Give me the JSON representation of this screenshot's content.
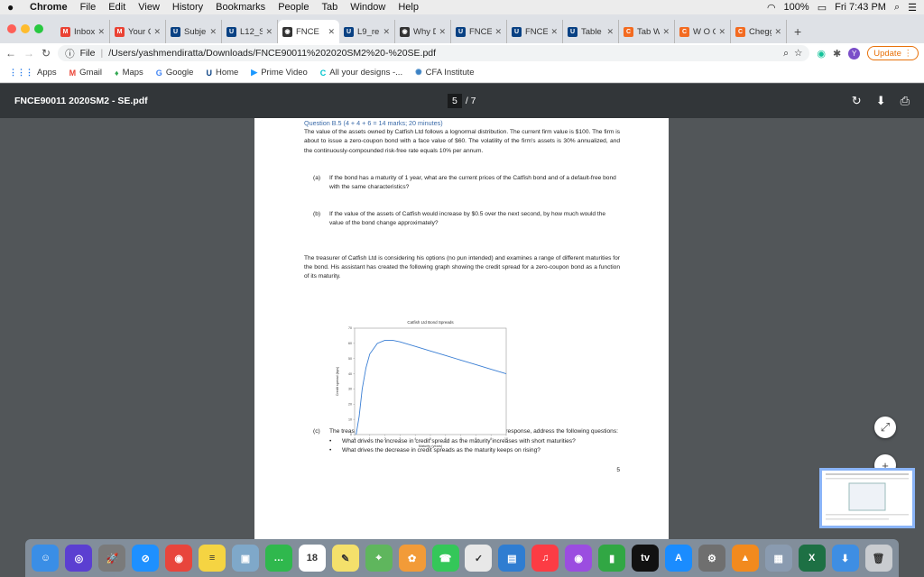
{
  "menubar": {
    "apple": "",
    "items": [
      "Chrome",
      "File",
      "Edit",
      "View",
      "History",
      "Bookmarks",
      "People",
      "Tab",
      "Window",
      "Help"
    ],
    "battery": "100%",
    "clock": "Fri 7:43 PM"
  },
  "tabs": [
    {
      "label": "Inbox",
      "icon": "M",
      "color": "#ea4335"
    },
    {
      "label": "Your C",
      "icon": "M",
      "color": "#ea4335"
    },
    {
      "label": "Subje",
      "icon": "U",
      "color": "#094183"
    },
    {
      "label": "L12_S",
      "icon": "U",
      "color": "#094183"
    },
    {
      "label": "FNCE",
      "icon": "◉",
      "color": "#333333"
    },
    {
      "label": "L9_re",
      "icon": "U",
      "color": "#094183"
    },
    {
      "label": "Why D",
      "icon": "◉",
      "color": "#333333"
    },
    {
      "label": "FNCE",
      "icon": "U",
      "color": "#094183"
    },
    {
      "label": "FNCE",
      "icon": "U",
      "color": "#094183"
    },
    {
      "label": "Table",
      "icon": "U",
      "color": "#094183"
    },
    {
      "label": "Tab W",
      "icon": "C",
      "color": "#f36b21"
    },
    {
      "label": "W O C",
      "icon": "C",
      "color": "#f36b21"
    },
    {
      "label": "Chegg",
      "icon": "C",
      "color": "#f36b21"
    }
  ],
  "active_tab_index": 4,
  "toolbar": {
    "file_label": "File",
    "url": "/Users/yashmendiratta/Downloads/FNCE90011%202020SM2%20-%20SE.pdf",
    "avatar_letter": "Y",
    "update_label": "Update"
  },
  "bookmarks": [
    {
      "label": "Apps",
      "icon": "⋮⋮⋮",
      "color": "#1a73e8"
    },
    {
      "label": "Gmail",
      "icon": "M",
      "color": "#ea4335"
    },
    {
      "label": "Maps",
      "icon": "♦",
      "color": "#34a853"
    },
    {
      "label": "Google",
      "icon": "G",
      "color": "#4285f4"
    },
    {
      "label": "Home",
      "icon": "U",
      "color": "#094183"
    },
    {
      "label": "Prime Video",
      "icon": "▶",
      "color": "#1a98ff"
    },
    {
      "label": "All your designs -...",
      "icon": "C",
      "color": "#00c4cc"
    },
    {
      "label": "CFA Institute",
      "icon": "✺",
      "color": "#3b82c4"
    }
  ],
  "pdf": {
    "title": "FNCE90011 2020SM2 - SE.pdf",
    "current_page": "5",
    "total_pages": "/ 7"
  },
  "question": {
    "heading": "Question B.5 (4 + 4 + 6 = 14 marks; 20 minutes)",
    "intro": "The value of the assets owned by Catfish Ltd follows a lognormal distribution. The current firm value is $100. The firm is about to issue a zero-coupon bond with a face value of $60. The volatility of the firm's assets is 30% annualized, and the continuously-compounded risk-free rate equals 10% per annum.",
    "a_label": "(a)",
    "a_text": "If the bond has a maturity of 1 year, what are the current prices of the Catfish bond and of a default-free bond with the same characteristics?",
    "b_label": "(b)",
    "b_text": "If the value of the assets of Catfish would increase by $0.5 over the next second, by how much would the value of the bond change approximately?",
    "treasurer": "The treasurer of Catfish Ltd is considering his options (no pun intended) and examines a range of different maturities for the bond. His assistant has created the following graph showing the credit spread for a zero-coupon bond as a function of its maturity.",
    "c_label": "(c)",
    "c_text": "The treasurer asks you for advice to understand the graph. In your response, address the following questions:",
    "bullets": [
      "What drives the increase in credit spread as the maturity increases with short maturities?",
      "What drives the decrease in credit spreads as the maturity keeps on rising?"
    ],
    "page_number": "5"
  },
  "chart_data": {
    "type": "line",
    "title": "Catfish Ltd Bond Spreads",
    "xlabel": "Maturity (years)",
    "ylabel": "Credit spread (bps)",
    "xlim": [
      0,
      10
    ],
    "ylim": [
      0,
      70
    ],
    "xticks": [
      "0",
      "1",
      "2",
      "3",
      "4",
      "5",
      "6",
      "7",
      "8",
      "9",
      "10"
    ],
    "yticks": [
      "0",
      "10",
      "20",
      "30",
      "40",
      "50",
      "60",
      "70"
    ],
    "grid": false,
    "series": [
      {
        "x": [
          0.1,
          0.3,
          0.5,
          0.75,
          1,
          1.5,
          2,
          2.5,
          3,
          3.5,
          4,
          5,
          6,
          7,
          8,
          9,
          10
        ],
        "values": [
          0,
          12,
          30,
          44,
          53,
          60,
          62,
          62,
          61,
          59.5,
          58,
          55,
          52,
          49,
          46,
          43,
          40
        ]
      }
    ]
  },
  "dock": [
    {
      "name": "finder",
      "icon": "☺",
      "color": "#3a8ee6"
    },
    {
      "name": "siri",
      "icon": "◎",
      "color": "#5b3fd1"
    },
    {
      "name": "launchpad",
      "icon": "🚀",
      "color": "#7a7a7a"
    },
    {
      "name": "safari",
      "icon": "⊘",
      "color": "#1e90ff"
    },
    {
      "name": "chrome",
      "icon": "◉",
      "color": "#e8453c"
    },
    {
      "name": "notes",
      "icon": "≡",
      "color": "#f5d442"
    },
    {
      "name": "preview",
      "icon": "▣",
      "color": "#7fa8c9"
    },
    {
      "name": "messages",
      "icon": "…",
      "color": "#2fb84d"
    },
    {
      "name": "calendar",
      "icon": "18",
      "color": "#ffffff"
    },
    {
      "name": "textedit",
      "icon": "✎",
      "color": "#f4e06b"
    },
    {
      "name": "maps",
      "icon": "⌖",
      "color": "#5fb65d"
    },
    {
      "name": "photos",
      "icon": "✿",
      "color": "#f29b38"
    },
    {
      "name": "facetime",
      "icon": "☎",
      "color": "#34c759"
    },
    {
      "name": "reminders",
      "icon": "✓",
      "color": "#e8e8e8"
    },
    {
      "name": "keynote",
      "icon": "▤",
      "color": "#2f7dd1"
    },
    {
      "name": "music",
      "icon": "♫",
      "color": "#fc3c44"
    },
    {
      "name": "podcasts",
      "icon": "◉",
      "color": "#9b4de0"
    },
    {
      "name": "numbers",
      "icon": "▮",
      "color": "#31a744"
    },
    {
      "name": "tv",
      "icon": "tv",
      "color": "#111111"
    },
    {
      "name": "app-store",
      "icon": "A",
      "color": "#1a8cff"
    },
    {
      "name": "system-preferences",
      "icon": "⚙",
      "color": "#6f6f6f"
    },
    {
      "name": "vlc",
      "icon": "▲",
      "color": "#f28a1e"
    },
    {
      "name": "image-capture",
      "icon": "▦",
      "color": "#8a9bb0"
    },
    {
      "name": "excel",
      "icon": "X",
      "color": "#1d7044"
    },
    {
      "name": "downloads",
      "icon": "⬇",
      "color": "#3e8ee3"
    },
    {
      "name": "trash",
      "icon": "🗑",
      "color": "#c9ccd0"
    }
  ]
}
